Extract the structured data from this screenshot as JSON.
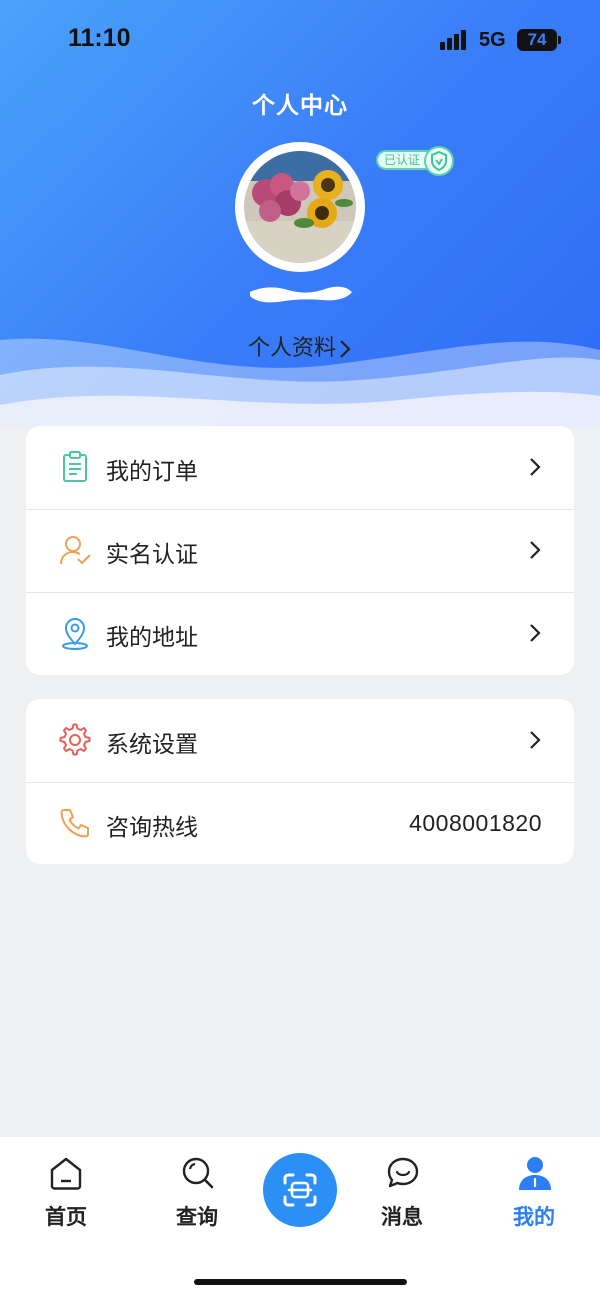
{
  "status_bar": {
    "time": "11:10",
    "network": "5G",
    "battery": "74"
  },
  "header": {
    "title": "个人中心",
    "verified_label": "已认证",
    "profile_link": "个人资料"
  },
  "menu_group_1": [
    {
      "label": "我的订单",
      "icon": "clipboard-icon",
      "color": "#4cc79a"
    },
    {
      "label": "实名认证",
      "icon": "user-check-icon",
      "color": "#f0a054"
    },
    {
      "label": "我的地址",
      "icon": "location-pin-icon",
      "color": "#3a9be8"
    }
  ],
  "menu_group_2": [
    {
      "label": "系统设置",
      "icon": "gear-icon",
      "color": "#e5615a"
    },
    {
      "label": "咨询热线",
      "icon": "phone-icon",
      "color": "#f0a054",
      "value": "4008001820"
    }
  ],
  "bottom_nav": {
    "items": [
      {
        "label": "首页",
        "icon": "home-icon"
      },
      {
        "label": "查询",
        "icon": "search-icon"
      },
      {
        "label": "",
        "icon": "scan-icon"
      },
      {
        "label": "消息",
        "icon": "chat-icon"
      },
      {
        "label": "我的",
        "icon": "person-icon",
        "active": true
      }
    ]
  },
  "colors": {
    "accent": "#2b7ef6",
    "header_gradient_start": "#4aa3fb",
    "header_gradient_end": "#2f6bf6",
    "background": "#eff0f2"
  }
}
